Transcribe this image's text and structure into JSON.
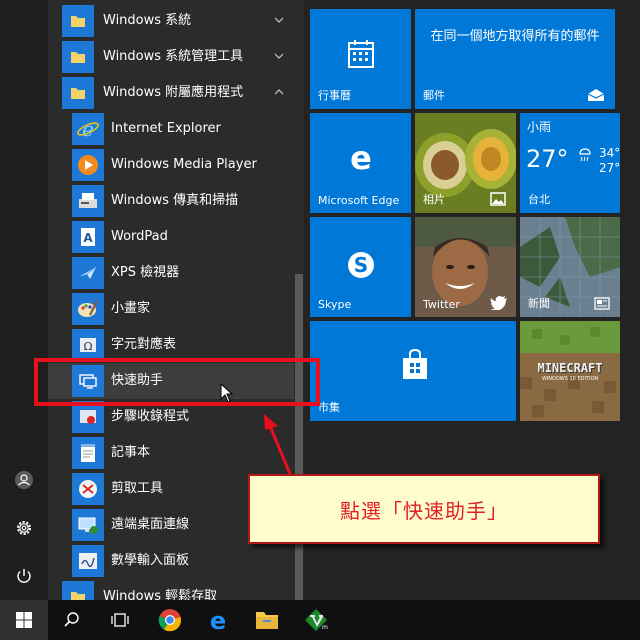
{
  "applist": {
    "items": [
      {
        "label": "Windows 系統",
        "type": "folder"
      },
      {
        "label": "Windows 系統管理工具",
        "type": "folder"
      },
      {
        "label": "Windows 附屬應用程式",
        "type": "folder-open"
      },
      {
        "label": "Internet Explorer",
        "icon": "internet-explorer-icon"
      },
      {
        "label": "Windows Media Player",
        "icon": "media-player-icon"
      },
      {
        "label": "Windows 傳真和掃描",
        "icon": "fax-scan-icon"
      },
      {
        "label": "WordPad",
        "icon": "wordpad-icon"
      },
      {
        "label": "XPS 檢視器",
        "icon": "xps-viewer-icon"
      },
      {
        "label": "小畫家",
        "icon": "paint-icon"
      },
      {
        "label": "字元對應表",
        "icon": "character-map-icon"
      },
      {
        "label": "快速助手",
        "icon": "quick-assist-icon"
      },
      {
        "label": "步驟收錄程式",
        "icon": "steps-recorder-icon"
      },
      {
        "label": "記事本",
        "icon": "notepad-icon"
      },
      {
        "label": "剪取工具",
        "icon": "snipping-tool-icon"
      },
      {
        "label": "遠端桌面連線",
        "icon": "remote-desktop-icon"
      },
      {
        "label": "數學輸入面板",
        "icon": "math-input-icon"
      },
      {
        "label": "Windows 輕鬆存取",
        "type": "folder"
      }
    ]
  },
  "tiles": {
    "calendar": {
      "label": "行事曆"
    },
    "mail": {
      "text": "在同一個地方取得所有的郵件",
      "label": "郵件"
    },
    "edge": {
      "label": "Microsoft Edge"
    },
    "photos": {
      "label": "相片"
    },
    "weather": {
      "condition": "小雨",
      "temp": "27°",
      "high": "34°",
      "low": "27°",
      "city": "台北"
    },
    "skype": {
      "label": "Skype"
    },
    "twitter": {
      "label": "Twitter"
    },
    "news": {
      "label": "新聞"
    },
    "store": {
      "label": "市集"
    },
    "minecraft": {
      "title": "MINECRAFT",
      "subtitle": "WINDOWS 10 EDITION"
    }
  },
  "annotation": {
    "text": "點選「快速助手」"
  },
  "colors": {
    "tile": "#0078d7",
    "annotation_border": "#e8101c",
    "callout_bg": "#fffccd"
  }
}
